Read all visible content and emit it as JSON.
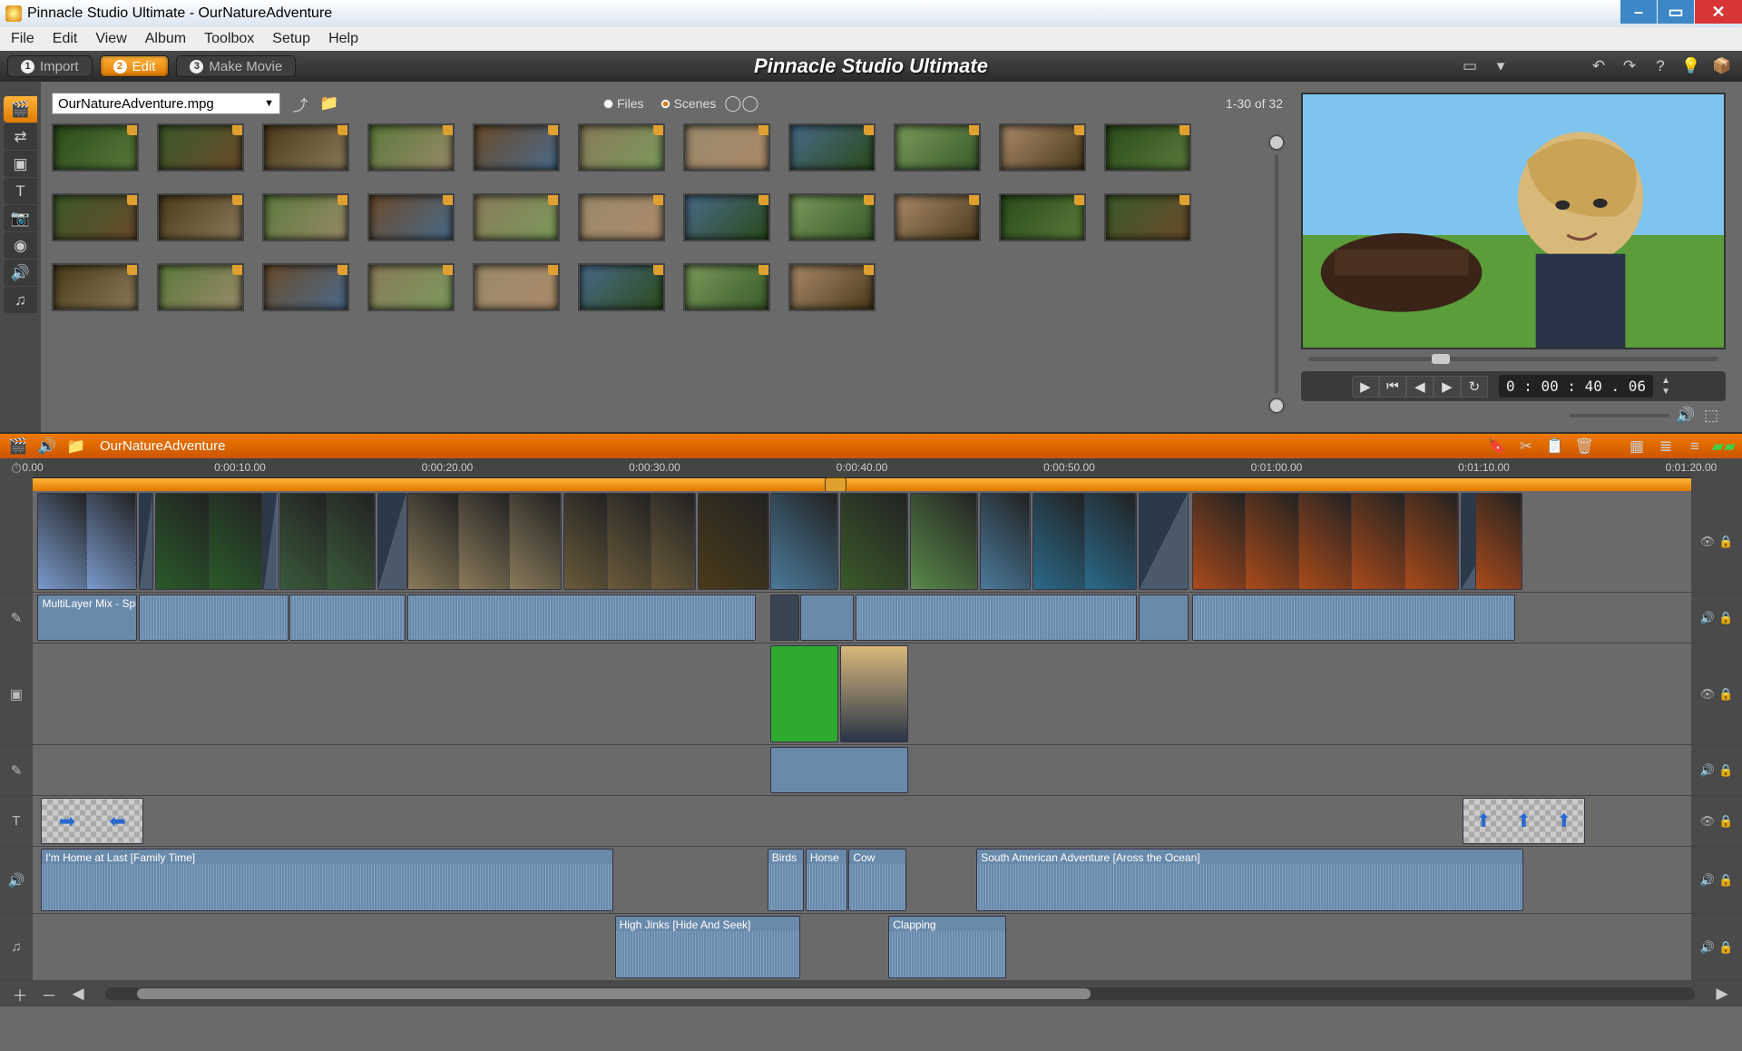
{
  "window": {
    "title": "Pinnacle Studio Ultimate - OurNatureAdventure"
  },
  "menu": [
    "File",
    "Edit",
    "View",
    "Album",
    "Toolbox",
    "Setup",
    "Help"
  ],
  "tabs": [
    {
      "n": "1",
      "label": "Import"
    },
    {
      "n": "2",
      "label": "Edit"
    },
    {
      "n": "3",
      "label": "Make Movie"
    }
  ],
  "app_title": "Pinnacle Studio Ultimate",
  "album": {
    "file": "OurNatureAdventure.mpg",
    "radio_files": "Files",
    "radio_scenes": "Scenes",
    "pager": "1-30 of 32",
    "thumb_count": 30
  },
  "preview": {
    "timecode": "0 : 00 : 40 . 06"
  },
  "timeline": {
    "project": "OurNatureAdventure",
    "ruler": [
      "0.00",
      "0:00:10.00",
      "0:00:20.00",
      "0:00:30.00",
      "0:00:40.00",
      "0:00:50.00",
      "0:01:00.00",
      "0:01:10.00",
      "0:01:20.00"
    ],
    "video_track_label": "MultiLayer Mix - Split",
    "music_clips": [
      {
        "label": "I'm Home at Last [Family Time]",
        "l": 0.5,
        "w": 34.5
      },
      {
        "label": "Birds",
        "l": 44.3,
        "w": 2.2
      },
      {
        "label": "Horse",
        "l": 46.6,
        "w": 2.5
      },
      {
        "label": "Cow",
        "l": 49.2,
        "w": 3.5
      },
      {
        "label": "South American Adventure [Aross the Ocean]",
        "l": 56.9,
        "w": 33
      }
    ],
    "sfx_clips": [
      {
        "label": "High Jinks [Hide And Seek]",
        "l": 35.1,
        "w": 11.2
      },
      {
        "label": "Clapping",
        "l": 51.6,
        "w": 7.1
      }
    ]
  }
}
